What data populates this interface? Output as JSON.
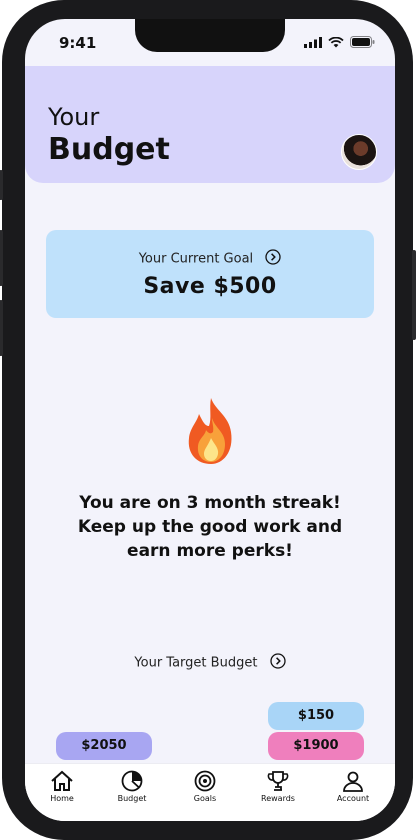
{
  "status": {
    "time": "9:41"
  },
  "header": {
    "line1": "Your",
    "line2": "Budget"
  },
  "goal": {
    "label": "Your Current Goal",
    "value": "Save $500"
  },
  "streak": {
    "line1": "You are on 3 month streak!",
    "line2": "Keep up the good work and",
    "line3": "earn more perks!"
  },
  "target": {
    "label": "Your Target Budget"
  },
  "amounts": {
    "left": "$2050",
    "top_right": "$150",
    "bottom_right": "$1900"
  },
  "colors": {
    "header_bg": "#d7d4fb",
    "goal_bg": "#bfe1fb",
    "left_pill": "#a8a6f2",
    "top_right_pill": "#a9d5f7",
    "bottom_right_pill": "#ef7fbd"
  },
  "tabs": [
    {
      "label": "Home",
      "icon": "home-icon"
    },
    {
      "label": "Budget",
      "icon": "pie-chart-icon"
    },
    {
      "label": "Goals",
      "icon": "target-icon"
    },
    {
      "label": "Rewards",
      "icon": "trophy-icon"
    },
    {
      "label": "Account",
      "icon": "user-icon"
    }
  ]
}
